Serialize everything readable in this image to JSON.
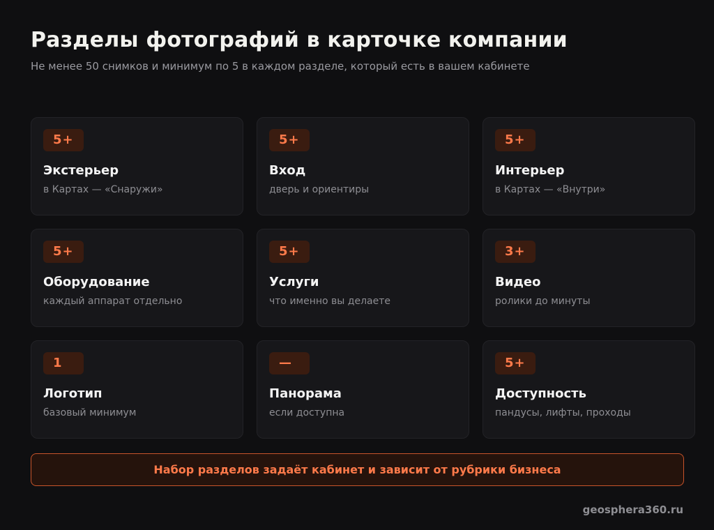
{
  "header": {
    "title": "Разделы фотографий в карточке компании",
    "subtitle": "Не менее 50 снимков и минимум по 5 в каждом разделе, который есть в вашем кабинете"
  },
  "sections": [
    {
      "badge": "5+",
      "title": "Экстерьер",
      "desc": "в Картах — «Снаружи»"
    },
    {
      "badge": "5+",
      "title": "Вход",
      "desc": "дверь и ориентиры"
    },
    {
      "badge": "5+",
      "title": "Интерьер",
      "desc": "в Картах — «Внутри»"
    },
    {
      "badge": "5+",
      "title": "Оборудование",
      "desc": "каждый аппарат отдельно"
    },
    {
      "badge": "5+",
      "title": "Услуги",
      "desc": "что именно вы делаете"
    },
    {
      "badge": "3+",
      "title": "Видео",
      "desc": "ролики до минуты"
    },
    {
      "badge": "1",
      "title": "Логотип",
      "desc": "базовый минимум"
    },
    {
      "badge": "—",
      "title": "Панорама",
      "desc": "если доступна"
    },
    {
      "badge": "5+",
      "title": "Доступность",
      "desc": "пандусы, лифты, проходы"
    }
  ],
  "notice": {
    "text": "Набор разделов задаёт кабинет и зависит от рубрики бизнеса"
  },
  "footer": {
    "site": "geosphera360.ru"
  },
  "colors": {
    "background": "#0f0f11",
    "card": "#17171a",
    "accent": "#ff7a4a",
    "badge_bg": "#3a1c10"
  }
}
